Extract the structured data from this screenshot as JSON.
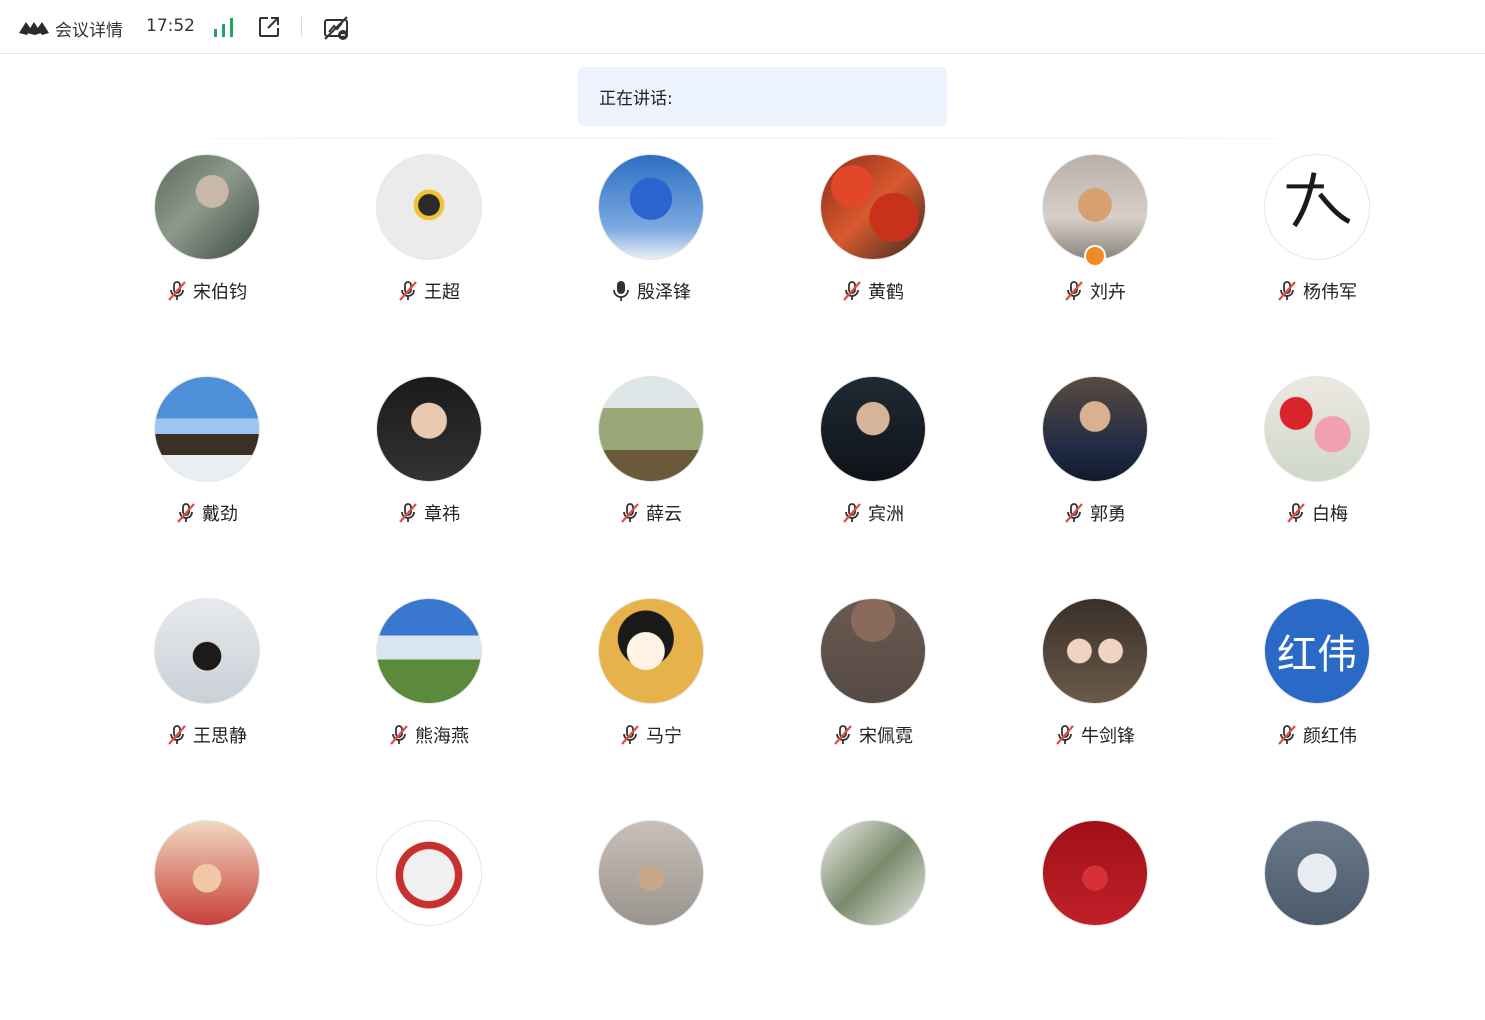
{
  "header": {
    "title": "会议详情",
    "time": "17:52",
    "icons": [
      "app-logo-icon",
      "signal-strength-icon",
      "popout-window-icon",
      "network-off-icon"
    ]
  },
  "speaking": {
    "label": "正在讲话:"
  },
  "colors": {
    "accent": "#2a6ac6",
    "signal": "#1ca860",
    "muted_mic": "#e54848",
    "speaking_bg": "#ecf2fe"
  },
  "participants": [
    {
      "name": "宋伯钧",
      "mic": "muted",
      "avatar": "photo-person"
    },
    {
      "name": "王超",
      "mic": "muted",
      "avatar": "cartoon-logo"
    },
    {
      "name": "殷泽锋",
      "mic": "on",
      "avatar": "cartoon-blue"
    },
    {
      "name": "黄鹤",
      "mic": "muted",
      "avatar": "red-leaves"
    },
    {
      "name": "刘卉",
      "mic": "muted",
      "avatar": "cat",
      "badge": "user-badge"
    },
    {
      "name": "杨伟军",
      "mic": "muted",
      "avatar": "fencing-logo"
    },
    {
      "name": "戴劲",
      "mic": "muted",
      "avatar": "seaside"
    },
    {
      "name": "章祎",
      "mic": "muted",
      "avatar": "portrait-dark"
    },
    {
      "name": "薛云",
      "mic": "muted",
      "avatar": "tree-house"
    },
    {
      "name": "宾洲",
      "mic": "muted",
      "avatar": "man-cap"
    },
    {
      "name": "郭勇",
      "mic": "muted",
      "avatar": "man-suit"
    },
    {
      "name": "白梅",
      "mic": "muted",
      "avatar": "peony"
    },
    {
      "name": "王思静",
      "mic": "muted",
      "avatar": "woman-city"
    },
    {
      "name": "熊海燕",
      "mic": "muted",
      "avatar": "sky-grass"
    },
    {
      "name": "马宁",
      "mic": "muted",
      "avatar": "cartoon-girl"
    },
    {
      "name": "宋佩霓",
      "mic": "muted",
      "avatar": "dark-shirt"
    },
    {
      "name": "牛剑锋",
      "mic": "muted",
      "avatar": "cartoon-family"
    },
    {
      "name": "颜红伟",
      "mic": "muted",
      "avatar": "text",
      "avatar_text": "红伟"
    },
    {
      "name": "",
      "mic": "",
      "avatar": "lantern-lady"
    },
    {
      "name": "",
      "mic": "",
      "avatar": "man-logo-ring"
    },
    {
      "name": "",
      "mic": "",
      "avatar": "child-street"
    },
    {
      "name": "",
      "mic": "",
      "avatar": "branches"
    },
    {
      "name": "",
      "mic": "",
      "avatar": "red-fortune"
    },
    {
      "name": "",
      "mic": "",
      "avatar": "white-blossoms"
    }
  ]
}
